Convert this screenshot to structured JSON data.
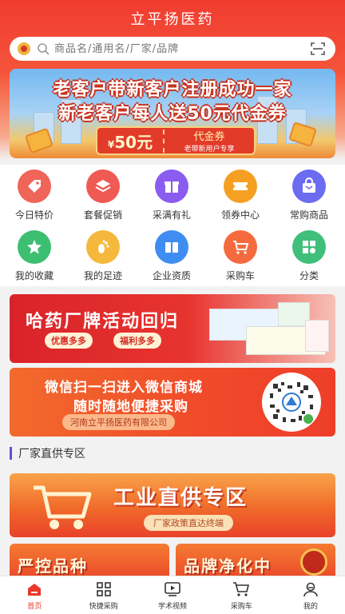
{
  "app": {
    "title": "立平扬医药"
  },
  "search": {
    "placeholder": "商品名/通用名/厂家/品牌"
  },
  "banner_promo": {
    "line1": "老客户带新客户注册成功一家",
    "line2": "新老客户每人送50元代金券",
    "coupon_amount": "50元",
    "coupon_symbol": "¥",
    "coupon_title": "代金券",
    "coupon_sub": "老带新用户专享"
  },
  "menu": [
    {
      "label": "今日特价",
      "icon": "tag-icon",
      "color": "#f0655a"
    },
    {
      "label": "套餐促销",
      "icon": "layers-icon",
      "color": "#ef5a55"
    },
    {
      "label": "采满有礼",
      "icon": "gift-icon",
      "color": "#8a5cf0"
    },
    {
      "label": "领券中心",
      "icon": "ticket-icon",
      "color": "#f5a023"
    },
    {
      "label": "常购商品",
      "icon": "bag-icon",
      "color": "#6b6cf0"
    },
    {
      "label": "我的收藏",
      "icon": "star-icon",
      "color": "#3cbf70"
    },
    {
      "label": "我的足迹",
      "icon": "footprint-icon",
      "color": "#f5b83c"
    },
    {
      "label": "企业资质",
      "icon": "book-icon",
      "color": "#3f8df0"
    },
    {
      "label": "采购车",
      "icon": "cart-icon",
      "color": "#f56b3f"
    },
    {
      "label": "分类",
      "icon": "category-icon",
      "color": "#3fbf7a"
    }
  ],
  "banner_brand": {
    "title": "哈药厂牌活动回归",
    "pill1": "优惠多多",
    "pill2": "福利多多"
  },
  "banner_wechat": {
    "line1": "微信扫一扫进入微信商城",
    "line2": "随时随地便捷采购",
    "company": "河南立平扬医药有限公司"
  },
  "section": {
    "title": "厂家直供专区"
  },
  "banner_factory": {
    "title": "工业直供专区",
    "subtitle": "厂家政策直达终端"
  },
  "banner_bottom": [
    {
      "title": "严控品种"
    },
    {
      "title": "品牌净化中"
    }
  ],
  "tabbar": [
    {
      "label": "首页",
      "icon": "home-icon",
      "active": true
    },
    {
      "label": "快捷采购",
      "icon": "grid-icon",
      "active": false
    },
    {
      "label": "学术视频",
      "icon": "video-icon",
      "active": false
    },
    {
      "label": "采购车",
      "icon": "cart-icon",
      "active": false
    },
    {
      "label": "我的",
      "icon": "user-icon",
      "active": false
    }
  ],
  "colors": {
    "brand_red": "#e8392a",
    "accent": "#f03c2f"
  }
}
